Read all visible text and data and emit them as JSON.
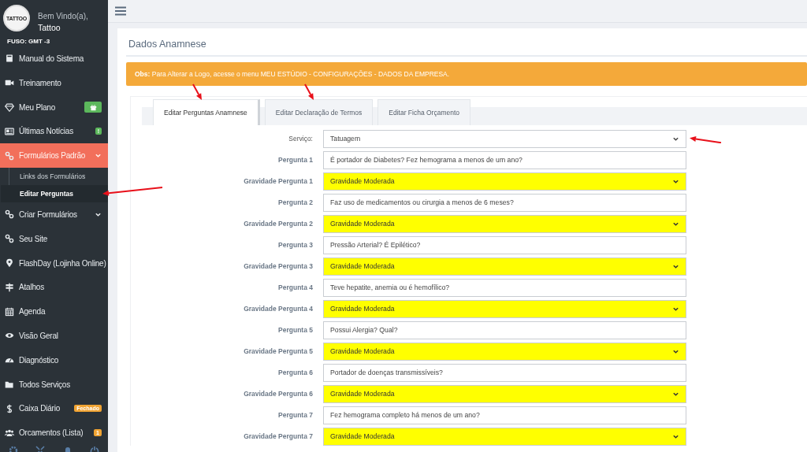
{
  "profile": {
    "greeting": "Bem Vindo(a),",
    "name": "Tattoo",
    "logo_text": "TATTOO",
    "timezone": "FUSO: GMT -3"
  },
  "sidebar": {
    "items": [
      {
        "label": "Manual do Sistema",
        "selected": false
      },
      {
        "label": "Treinamento",
        "selected": false
      },
      {
        "label": "Meu Plano",
        "selected": false,
        "badge": {
          "kind": "gift",
          "color": "#5cb85c"
        }
      },
      {
        "label": "Últimas Notícias",
        "selected": false,
        "badge": {
          "kind": "text",
          "text": "!",
          "color": "#5cb85c"
        }
      },
      {
        "label": "Formulários Padrão",
        "selected": true,
        "caret": true,
        "children": [
          {
            "label": "Links dos Formulários",
            "selected": false,
            "arrow": false
          },
          {
            "label": "Editar Perguntas",
            "selected": true,
            "arrow": true
          }
        ]
      },
      {
        "label": "Criar Formulários",
        "selected": false,
        "caret": true
      },
      {
        "label": "Seu Site",
        "selected": false
      },
      {
        "label": "FlashDay (Lojinha Online)",
        "selected": false
      },
      {
        "label": "Atalhos",
        "selected": false
      },
      {
        "label": "Agenda",
        "selected": false
      },
      {
        "label": "Visão Geral",
        "selected": false
      },
      {
        "label": "Diagnóstico",
        "selected": false
      },
      {
        "label": "Todos Serviços",
        "selected": false
      },
      {
        "label": "Caixa Diário",
        "selected": false,
        "badge": {
          "kind": "text",
          "text": "Fechado",
          "color": "#f0a332"
        }
      },
      {
        "label": "Orcamentos (Lista)",
        "selected": false,
        "badge": {
          "kind": "text",
          "text": "1",
          "color": "#f0a332"
        }
      }
    ]
  },
  "page": {
    "title": "Dados Anamnese",
    "notice": {
      "label": "Obs:",
      "text": "Para Alterar a Logo, acesse o menu MEU ESTÚDIO - CONFIGURAÇÕES - DADOS DA EMPRESA."
    },
    "tabs": [
      {
        "label": "Editar Perguntas Anamnese",
        "selected": true,
        "arrow": true
      },
      {
        "label": "Editar Declaração de Termos",
        "selected": false,
        "arrow": true
      },
      {
        "label": "Editar Ficha Orçamento",
        "selected": false,
        "arrow": false
      }
    ],
    "form": [
      {
        "label": "Serviço:",
        "kind": "select",
        "value": "Tatuagem",
        "highlight": false,
        "arrow": true
      },
      {
        "label": "Pergunta 1",
        "kind": "text",
        "value": "É portador de Diabetes? Fez hemograma a menos de um ano?"
      },
      {
        "label": "Gravidade Pergunta 1",
        "kind": "select",
        "value": "Gravidade Moderada",
        "highlight": true,
        "arrow": false
      },
      {
        "label": "Pergunta 2",
        "kind": "text",
        "value": "Faz uso de medicamentos ou cirurgia a menos de 6 meses?"
      },
      {
        "label": "Gravidade Pergunta 2",
        "kind": "select",
        "value": "Gravidade Moderada",
        "highlight": true,
        "arrow": false
      },
      {
        "label": "Pergunta 3",
        "kind": "text",
        "value": "Pressão Arterial? É Epilético?"
      },
      {
        "label": "Gravidade Pergunta 3",
        "kind": "select",
        "value": "Gravidade Moderada",
        "highlight": true,
        "arrow": false
      },
      {
        "label": "Pergunta 4",
        "kind": "text",
        "value": "Teve hepatite, anemia ou é hemofílico?"
      },
      {
        "label": "Gravidade Pergunta 4",
        "kind": "select",
        "value": "Gravidade Moderada",
        "highlight": true,
        "arrow": false
      },
      {
        "label": "Pergunta 5",
        "kind": "text",
        "value": "Possui Alergia? Qual?"
      },
      {
        "label": "Gravidade Pergunta 5",
        "kind": "select",
        "value": "Gravidade Moderada",
        "highlight": true,
        "arrow": false
      },
      {
        "label": "Pergunta 6",
        "kind": "text",
        "value": "Portador de doenças transmissíveis?"
      },
      {
        "label": "Gravidade Pergunta 6",
        "kind": "select",
        "value": "Gravidade Moderada",
        "highlight": true,
        "arrow": false
      },
      {
        "label": "Pergunta 7",
        "kind": "text",
        "value": "Fez hemograma completo há menos de um ano?"
      },
      {
        "label": "Gravidade Pergunta 7",
        "kind": "select",
        "value": "Gravidade Moderada",
        "highlight": true,
        "arrow": false
      }
    ]
  }
}
